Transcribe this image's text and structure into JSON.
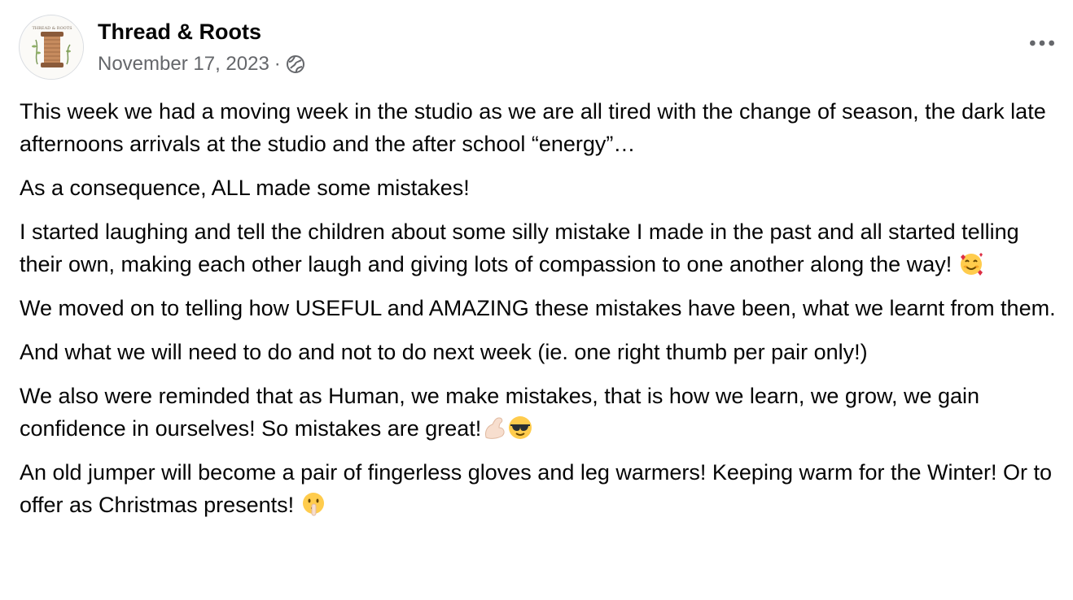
{
  "post": {
    "author": "Thread & Roots",
    "avatar_text": "THREAD & ROOTS",
    "date": "November 17, 2023",
    "separator": "·",
    "audience_icon": "globe-icon",
    "more_icon": "more-options-icon"
  },
  "body": {
    "p1": "This week we had a moving week in the studio as we are all tired with the change of season, the dark late afternoons arrivals at the studio and the after school “energy”…",
    "p2": "As a consequence, ALL made some mistakes!",
    "p3": "I started laughing and tell the children about some silly mistake I made in the past and all started telling their own, making each other laugh and giving lots of compassion to one another along the way! ",
    "p3_emoji": "smiling-face-with-hearts-emoji",
    "p4": "We moved on to telling how USEFUL and AMAZING these mistakes have been, what we learnt from them.",
    "p5": "And what we will need to do and not to do next week (ie. one right thumb per pair only!)",
    "p6": "We also were reminded that as Human, we make mistakes, that is how we learn, we grow, we gain confidence in ourselves! So mistakes are great!",
    "p6_emojis": [
      "flexed-biceps-emoji",
      "sunglasses-face-emoji"
    ],
    "p7": "An old jumper will become a pair of fingerless gloves and leg warmers! Keeping warm for the Winter! Or to offer as Christmas presents! ",
    "p7_emoji": "shushing-face-emoji"
  },
  "colors": {
    "text_primary": "#050505",
    "text_secondary": "#65676b",
    "background": "#ffffff"
  }
}
